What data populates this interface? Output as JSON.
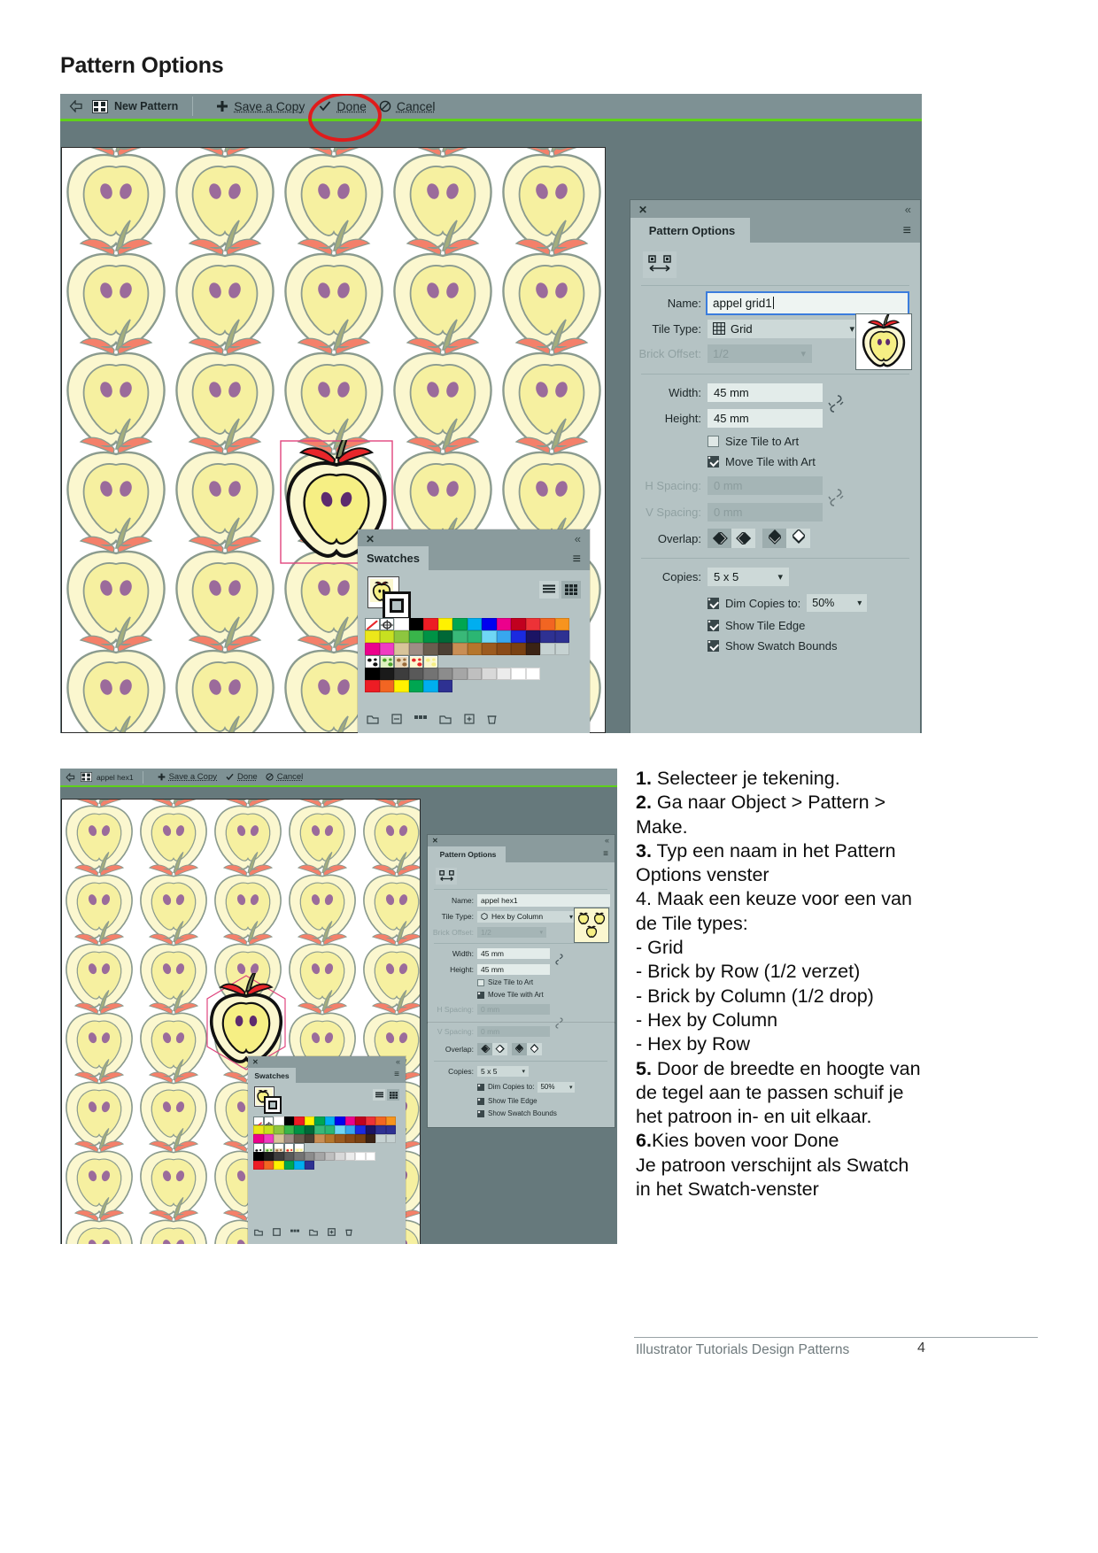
{
  "page": {
    "title": "Pattern Options"
  },
  "top_screenshot": {
    "toolbar": {
      "back_icon": "back-arrow-icon",
      "pattern_icon": "pattern-swatch-icon",
      "new_pattern_label": "New Pattern",
      "save_copy_icon": "plus-icon",
      "save_copy_label": "Save a Copy",
      "done_icon": "check-icon",
      "done_label": "Done",
      "cancel_icon": "cancel-icon",
      "cancel_label": "Cancel"
    },
    "annotation": {
      "shape": "red-ellipse-around-done"
    },
    "pattern_options_panel": {
      "close_label": "✕",
      "collapse_label": "«",
      "menu_label": "≡",
      "tab_label": "Pattern Options",
      "tile_edit_icon": "tile-edit-icon",
      "name_label": "Name:",
      "name_value": "appel grid1",
      "tile_type_label": "Tile Type:",
      "tile_type_icon": "grid-icon",
      "tile_type_value": "Grid",
      "brick_offset_label": "Brick Offset:",
      "brick_offset_value": "1/2",
      "width_label": "Width:",
      "width_value": "45 mm",
      "height_label": "Height:",
      "height_value": "45 mm",
      "link_icon": "broken-link-icon",
      "size_tile_label": "Size Tile to Art",
      "size_tile_checked": false,
      "move_tile_label": "Move Tile with Art",
      "move_tile_checked": true,
      "h_spacing_label": "H Spacing:",
      "h_spacing_value": "0 mm",
      "v_spacing_label": "V Spacing:",
      "v_spacing_value": "0 mm",
      "overlap_label": "Overlap:",
      "overlap_options": [
        "left-in-front",
        "right-in-front",
        "top-in-front",
        "bottom-in-front"
      ],
      "overlap_selected": [
        0,
        2
      ],
      "copies_label": "Copies:",
      "copies_value": "5 x 5",
      "dim_copies_label": "Dim Copies to:",
      "dim_copies_checked": true,
      "dim_copies_value": "50%",
      "show_tile_edge_label": "Show Tile Edge",
      "show_tile_edge_checked": true,
      "show_swatch_bounds_label": "Show Swatch Bounds",
      "show_swatch_bounds_checked": true
    },
    "swatches_panel": {
      "close_label": "✕",
      "collapse_label": "«",
      "menu_label": "≡",
      "tab_label": "Swatches",
      "pattern_swatch_icon": "apple-pattern-swatch-icon",
      "view_list_icon": "list-view-icon",
      "view_grid_icon": "grid-view-icon",
      "view_selected": "grid",
      "rows": [
        [
          "none",
          "registration",
          "#ffffff",
          "#000000",
          "#ed1c24",
          "#fff200",
          "#00a651",
          "#00aeef",
          "#0000f0",
          "#ec008c",
          "#c1001f",
          "#ed3237",
          "#f26522",
          "#f7941e"
        ],
        [
          "#ece71a",
          "#c7e021",
          "#8dc63f",
          "#39b54a",
          "#009245",
          "#006837",
          "#39b878",
          "#2bb673",
          "#6fd7f5",
          "#38a7ef",
          "#1b2ae0",
          "#1b1464",
          "#2e3192",
          "#2e3192"
        ],
        [
          "#ec008c",
          "#ef3cc2",
          "#d8c49a",
          "#9e8d85",
          "#6a5d4f",
          "#4b3f33",
          "#c98e54",
          "#b5762c",
          "#9c5a1e",
          "#8a4a17",
          "#7a4112",
          "#3b2314",
          "#c6d2d2",
          "#c6d2d2"
        ],
        [
          "patt-bw",
          "patt-green",
          "patt-dots",
          "patt-apple1",
          "patt-apple2"
        ],
        [
          "#000000",
          "#1a1a1a",
          "#3d3d3d",
          "#595959",
          "#737373",
          "#8c8c8c",
          "#a6a6a6",
          "#bfbfbf",
          "#d9d9d9",
          "#ececec",
          "#ffffff",
          "#ffffff"
        ],
        [
          "#ed1c24",
          "#f26522",
          "#fff200",
          "#00a651",
          "#00aeef",
          "#2e3192"
        ]
      ],
      "footer_icons": [
        "swatch-libraries-icon",
        "show-kind-icon",
        "swatch-options-icon",
        "new-group-icon",
        "new-swatch-icon",
        "delete-swatch-icon"
      ]
    }
  },
  "bottom_screenshot": {
    "toolbar": {
      "back_icon": "back-arrow-icon",
      "pattern_icon": "pattern-swatch-icon",
      "pattern_name": "appel hex1",
      "save_copy_icon": "plus-icon",
      "save_copy_label": "Save a Copy",
      "done_icon": "check-icon",
      "done_label": "Done",
      "cancel_icon": "cancel-icon",
      "cancel_label": "Cancel"
    },
    "pattern_options_panel": {
      "close_label": "✕",
      "collapse_label": "«",
      "menu_label": "≡",
      "tab_label": "Pattern Options",
      "tile_edit_icon": "tile-edit-icon",
      "name_label": "Name:",
      "name_value": "appel hex1",
      "tile_type_label": "Tile Type:",
      "tile_type_icon": "hex-icon",
      "tile_type_value": "Hex by Column",
      "brick_offset_label": "Brick Offset:",
      "brick_offset_value": "1/2",
      "width_label": "Width:",
      "width_value": "45 mm",
      "height_label": "Height:",
      "height_value": "45 mm",
      "link_icon": "broken-link-icon",
      "size_tile_label": "Size Tile to Art",
      "size_tile_checked": false,
      "move_tile_label": "Move Tile with Art",
      "move_tile_checked": true,
      "h_spacing_label": "H Spacing:",
      "h_spacing_value": "0 mm",
      "v_spacing_label": "V Spacing:",
      "v_spacing_value": "0 mm",
      "overlap_label": "Overlap:",
      "overlap_selected": [
        0,
        2
      ],
      "copies_label": "Copies:",
      "copies_value": "5 x 5",
      "dim_copies_label": "Dim Copies to:",
      "dim_copies_checked": true,
      "dim_copies_value": "50%",
      "show_tile_edge_label": "Show Tile Edge",
      "show_tile_edge_checked": true,
      "show_swatch_bounds_label": "Show Swatch Bounds",
      "show_swatch_bounds_checked": true
    },
    "swatches_panel": {
      "close_label": "✕",
      "collapse_label": "«",
      "menu_label": "≡",
      "tab_label": "Swatches",
      "pattern_swatch_icon": "apple-pattern-swatch-icon",
      "view_list_icon": "list-view-icon",
      "view_grid_icon": "grid-view-icon"
    }
  },
  "instructions": {
    "lines": [
      {
        "num": "1.",
        "text": " Selecteer je tekening."
      },
      {
        "num": "2.",
        "text": " Ga naar Object > Pattern > Make."
      },
      {
        "num": "3.",
        "text": " Typ een naam in het Pattern Options venster"
      },
      {
        "num": "",
        "text": "4. Maak een keuze voor een van de Tile types:"
      },
      {
        "num": "",
        "text": "- Grid"
      },
      {
        "num": "",
        "text": "- Brick by Row (1/2 verzet)"
      },
      {
        "num": "",
        "text": "- Brick by Column (1/2 drop)"
      },
      {
        "num": "",
        "text": "- Hex by Column"
      },
      {
        "num": "",
        "text": "- Hex by Row"
      },
      {
        "num": "5.",
        "text": " Door de breedte en hoogte van de tegel aan te passen schuif je het patroon in- en uit elkaar."
      },
      {
        "num": "6.",
        "text": "Kies boven voor Done"
      },
      {
        "num": "",
        "text": "Je patroon verschijnt als Swatch in het Swatch-venster"
      }
    ]
  },
  "footer": {
    "text": "Illustrator Tutorials Design Patterns",
    "page_number": "4"
  },
  "colors": {
    "shell_bg": "#66797c",
    "toolbar_bg": "#7e9194",
    "green_line": "#5fd11a",
    "panel_bg": "#b5c3c4",
    "panel_title_bg": "#8a9b9d",
    "annotation_red": "#e01b1b",
    "apple_flesh": "#fbf6c8",
    "apple_core": "#f5ef96",
    "apple_outline": "#8b9b8f",
    "apple_leaf": "#a3ad7d",
    "apple_red": "#f4806a",
    "seed": "#9b6b9b"
  }
}
